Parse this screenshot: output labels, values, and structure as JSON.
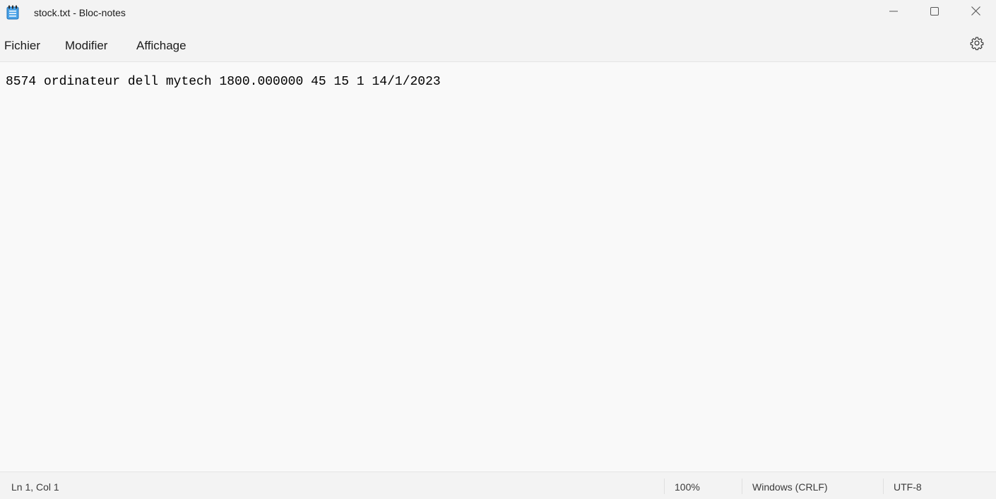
{
  "window": {
    "title": "stock.txt - Bloc-notes"
  },
  "titlebar_icons": {
    "app": "notepad-icon",
    "minimize": "minimize-icon",
    "maximize": "maximize-icon",
    "close": "close-icon"
  },
  "menu": {
    "items": [
      {
        "label": "Fichier"
      },
      {
        "label": "Modifier"
      },
      {
        "label": "Affichage"
      }
    ],
    "settings_icon": "gear-icon"
  },
  "editor": {
    "content": "8574 ordinateur dell mytech 1800.000000 45 15 1 14/1/2023"
  },
  "status": {
    "position": "Ln 1, Col 1",
    "zoom": "100%",
    "line_ending": "Windows (CRLF)",
    "encoding": "UTF-8"
  },
  "colors": {
    "chrome_bg": "#f3f3f3",
    "editor_bg": "#f9f9f9",
    "app_icon_blue": "#3a8fd6"
  }
}
